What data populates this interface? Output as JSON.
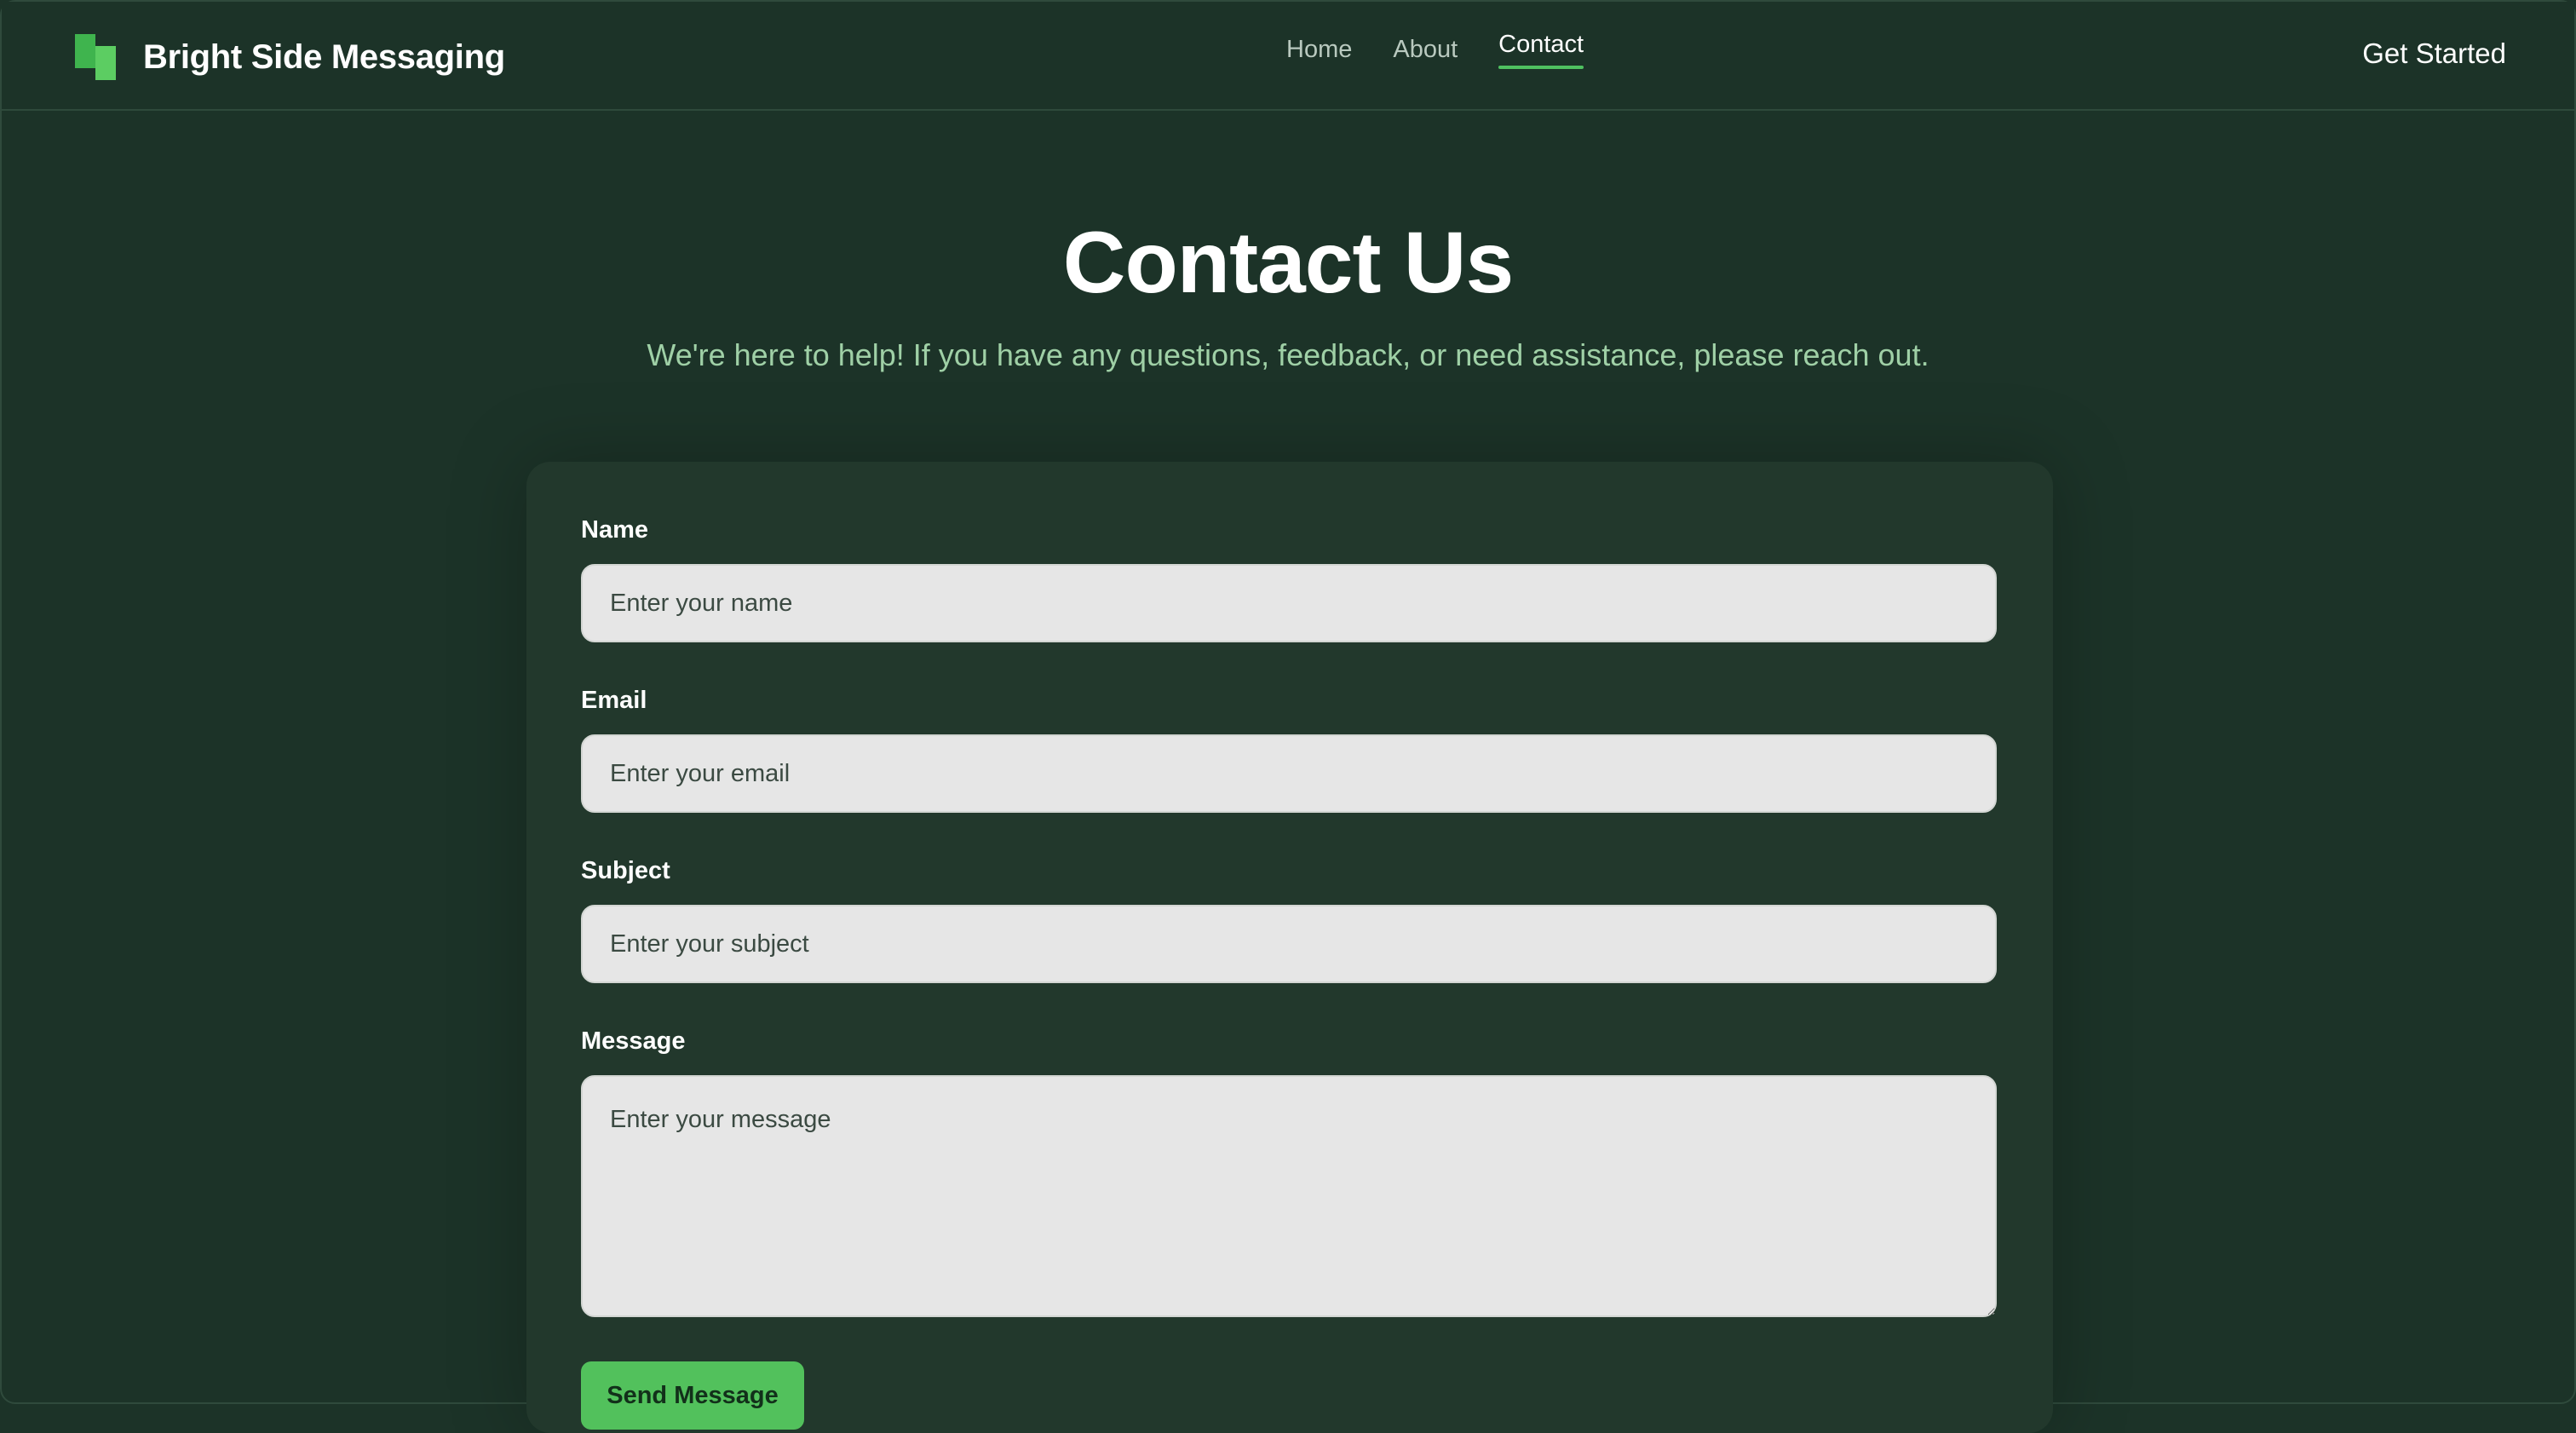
{
  "header": {
    "brand_name": "Bright Side Messaging",
    "logo_icon": "brand-logo-icon",
    "nav": [
      {
        "label": "Home",
        "active": false
      },
      {
        "label": "About",
        "active": false
      },
      {
        "label": "Contact",
        "active": true
      }
    ],
    "cta_label": "Get Started"
  },
  "hero": {
    "title": "Contact Us",
    "subtitle": "We're here to help! If you have any questions, feedback, or need assistance, please reach out."
  },
  "form": {
    "name": {
      "label": "Name",
      "placeholder": "Enter your name",
      "value": ""
    },
    "email": {
      "label": "Email",
      "placeholder": "Enter your email",
      "value": ""
    },
    "subject": {
      "label": "Subject",
      "placeholder": "Enter your subject",
      "value": ""
    },
    "message": {
      "label": "Message",
      "placeholder": "Enter your message",
      "value": ""
    },
    "submit_label": "Send Message"
  },
  "colors": {
    "background": "#1c3328",
    "card": "#22382c",
    "accent": "#52c15c",
    "subtitle": "#9fd0a6",
    "input_bg": "#e6e6e6"
  }
}
